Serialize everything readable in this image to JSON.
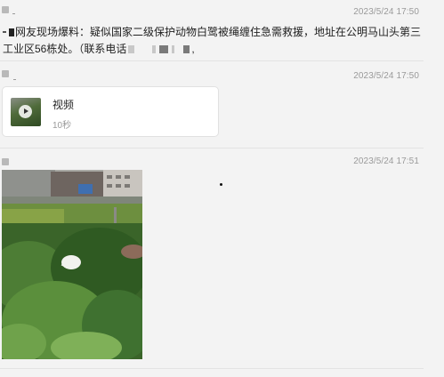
{
  "messages": [
    {
      "timestamp": "2023/5/24 17:50",
      "text_before": "网友现场爆料：疑似国家二级保护动物白鹭被绳缠住急需救援，地址在公明马山头第三工业区56栋处。（联系电话",
      "text_after": ","
    },
    {
      "timestamp": "2023/5/24 17:50",
      "video": {
        "title": "视频",
        "duration": "10秒"
      }
    },
    {
      "timestamp": "2023/5/24 17:51",
      "image": {
        "description_icon": "photo-egret-in-tree"
      }
    }
  ],
  "colors": {
    "background": "#f3f3f3",
    "timestamp": "#9a9a9a",
    "card": "#ffffff"
  }
}
